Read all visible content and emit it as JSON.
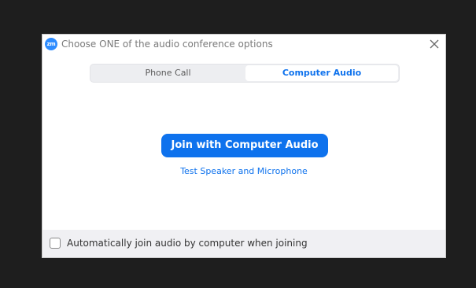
{
  "window": {
    "logo_text": "zm",
    "title": "Choose ONE of the audio conference options",
    "close_icon": "close-icon"
  },
  "tabs": [
    {
      "label": "Phone Call",
      "selected": false
    },
    {
      "label": "Computer Audio",
      "selected": true
    }
  ],
  "main": {
    "join_button_label": "Join with Computer Audio",
    "test_link_label": "Test Speaker and Microphone"
  },
  "footer": {
    "auto_join_label": "Automatically join audio by computer when joining",
    "auto_join_checked": false
  },
  "colors": {
    "accent": "#0e72ed",
    "logo": "#2d8cff",
    "background": "#1e1e1e"
  }
}
